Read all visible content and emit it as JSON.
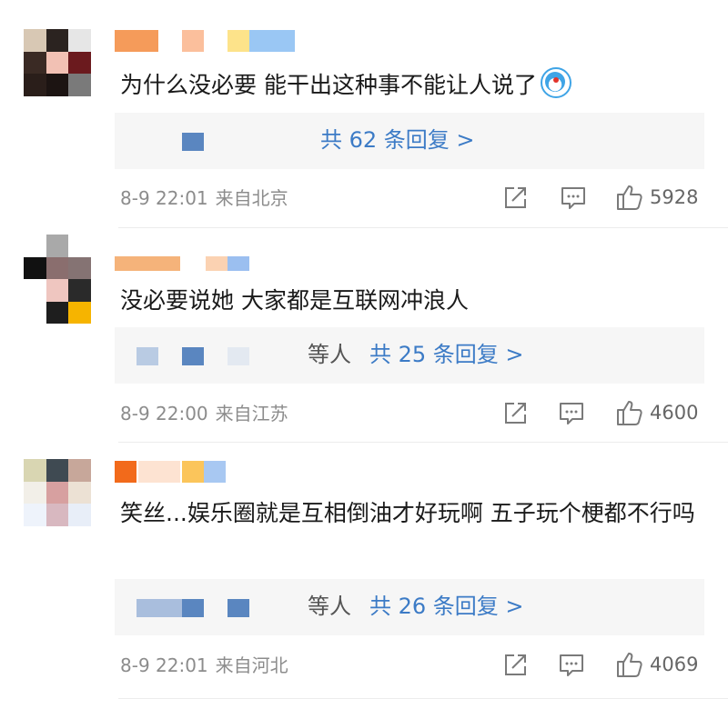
{
  "colors": {
    "link": "#3c7bc6",
    "meta": "#8c8c8c",
    "reply_bg": "#f6f6f6"
  },
  "comments": [
    {
      "avatar": [
        "#d8c8b4",
        "#2b2320",
        "#e6e6e6",
        "#3a2a24",
        "#f2c1b4",
        "#6b1a1e",
        "#2a1e1a",
        "#1c1412",
        "#7a7a7a"
      ],
      "username_blocks": [
        "#f59b5a",
        "#fbbf9c",
        "#fde38a",
        "#9ac7f4"
      ],
      "text": "为什么没必要 能干出这种事不能让人说了",
      "reply": {
        "who": "",
        "link": "共 62 条回复 >"
      },
      "time": "8-9 22:01",
      "location": "来自北京",
      "likes": "5928"
    },
    {
      "avatar": [
        "#ffffff",
        "#a9a9a9",
        "#ffffff",
        "#111111",
        "#8a6e6e",
        "#857373",
        "#ffffff",
        "#efc6c0",
        "#2a2a2a"
      ],
      "username_blocks": [
        "#f5b37a",
        "#fbd2b2",
        "#9bbff0"
      ],
      "text": "没必要说她 大家都是互联网冲浪人",
      "reply": {
        "who": "等人",
        "link": "共 25 条回复 >"
      },
      "time": "8-9 22:00",
      "location": "来自江苏",
      "likes": "4600"
    },
    {
      "avatar": [
        "#d9d6b2",
        "#3f4a52",
        "#c7a79a",
        "#f2efe8",
        "#d7a0a0",
        "#ece1d4",
        "#eef3fb",
        "#d8b8c0",
        "#e8eef8"
      ],
      "username_blocks": [
        "#f26a1b",
        "#fde3d2",
        "#fbc55b",
        "#a8c8f2"
      ],
      "text": "笑丝...娱乐圈就是互相倒油才好玩啊 五子玩个梗都不行吗",
      "reply": {
        "who": "等人",
        "link": "共 26 条回复 >"
      },
      "time": "8-9 22:01",
      "location": "来自河北",
      "likes": "4069"
    }
  ]
}
